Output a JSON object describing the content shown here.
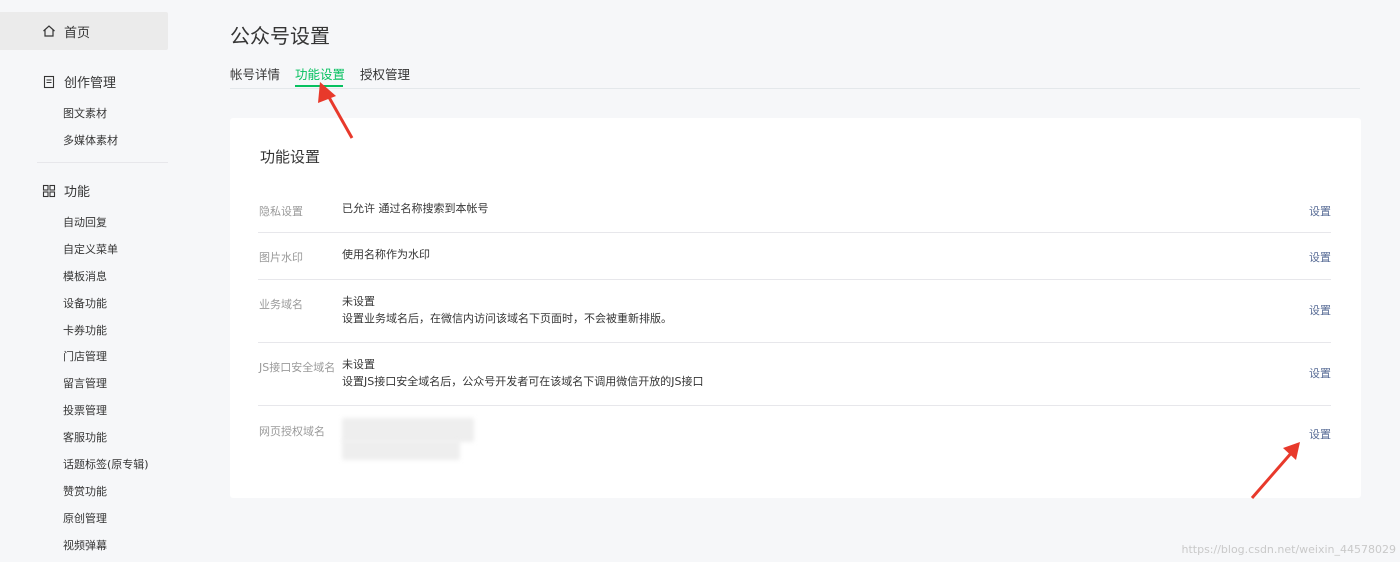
{
  "sidebar": {
    "home": {
      "label": "首页",
      "icon": "home-icon"
    },
    "creation": {
      "label": "创作管理",
      "icon": "document-icon",
      "items": [
        {
          "label": "图文素材"
        },
        {
          "label": "多媒体素材"
        }
      ]
    },
    "features": {
      "label": "功能",
      "icon": "grid-icon",
      "items": [
        {
          "label": "自动回复"
        },
        {
          "label": "自定义菜单"
        },
        {
          "label": "模板消息"
        },
        {
          "label": "设备功能"
        },
        {
          "label": "卡券功能"
        },
        {
          "label": "门店管理"
        },
        {
          "label": "留言管理"
        },
        {
          "label": "投票管理"
        },
        {
          "label": "客服功能"
        },
        {
          "label": "话题标签(原专辑)"
        },
        {
          "label": "赞赏功能"
        },
        {
          "label": "原创管理"
        },
        {
          "label": "视频弹幕"
        }
      ]
    }
  },
  "page": {
    "title": "公众号设置",
    "tabs": [
      {
        "label": "帐号详情",
        "active": false
      },
      {
        "label": "功能设置",
        "active": true
      },
      {
        "label": "授权管理",
        "active": false
      }
    ]
  },
  "card": {
    "title": "功能设置",
    "rows": [
      {
        "label": "隐私设置",
        "value_line1": "已允许 通过名称搜索到本帐号",
        "value_line2": "",
        "action": "设置"
      },
      {
        "label": "图片水印",
        "value_line1": "使用名称作为水印",
        "value_line2": "",
        "action": "设置"
      },
      {
        "label": "业务域名",
        "value_line1": "未设置",
        "value_line2": "设置业务域名后，在微信内访问该域名下页面时，不会被重新排版。",
        "action": "设置"
      },
      {
        "label": "JS接口安全域名",
        "value_line1": "未设置",
        "value_line2": "设置JS接口安全域名后，公众号开发者可在该域名下调用微信开放的JS接口",
        "action": "设置"
      },
      {
        "label": "网页授权域名",
        "value_line1": "",
        "value_line2": "",
        "action": "设置"
      }
    ]
  },
  "watermark": "https://blog.csdn.net/weixin_44578029",
  "colors": {
    "accent": "#07c160",
    "link": "#576b95",
    "annotation_arrow": "#e8392b"
  }
}
